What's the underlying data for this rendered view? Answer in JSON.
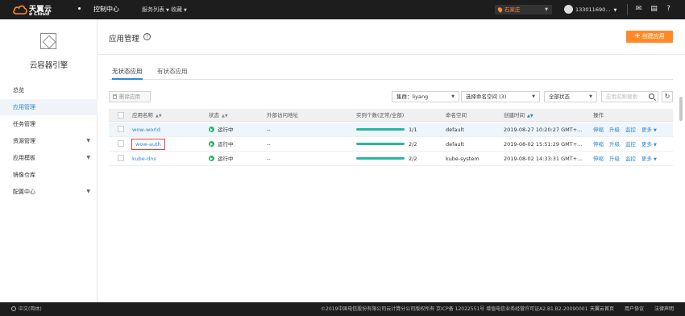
{
  "topbar": {
    "logo_cn": "天翼云",
    "logo_en": "e Cloud",
    "nav": [
      {
        "label": "控制中心"
      },
      {
        "label": "服务列表"
      },
      {
        "label": "收藏"
      }
    ],
    "region": "石家庄",
    "user": "133011690...",
    "icons": [
      "mail-icon",
      "file-icon",
      "help-icon"
    ]
  },
  "sidebar": {
    "title": "云容器引擎",
    "items": [
      {
        "label": "总览"
      },
      {
        "label": "应用管理"
      },
      {
        "label": "任务管理"
      },
      {
        "label": "资源管理"
      },
      {
        "label": "应用模板"
      },
      {
        "label": "镜像仓库"
      },
      {
        "label": "配置中心"
      }
    ]
  },
  "page": {
    "title": "应用管理",
    "create_label": "创建应用",
    "tabs": [
      {
        "label": "无状态应用"
      },
      {
        "label": "有状态应用"
      }
    ]
  },
  "toolbar": {
    "delete_label": "删除应用",
    "cluster_label": "集群：liyang",
    "namespace_label": "选择命名空间 (3)",
    "status_label": "全部状态",
    "search_placeholder": "应用名称搜索"
  },
  "table": {
    "headers": [
      "应用名称",
      "状态",
      "外部访问地址",
      "实例个数(正常/全部)",
      "命名空间",
      "创建时间",
      "操作"
    ],
    "rows": [
      {
        "name": "wow-world",
        "status": "运行中",
        "address": "--",
        "instances": "1/1",
        "ratio": 1,
        "namespace": "default",
        "created": "2019-08-27 10:20:27 GMT+..."
      },
      {
        "name": "wow-auth",
        "status": "运行中",
        "address": "--",
        "instances": "2/2",
        "ratio": 1,
        "namespace": "default",
        "created": "2019-08-02 15:51:29 GMT+..."
      },
      {
        "name": "kube-dns",
        "status": "运行中",
        "address": "--",
        "instances": "2/2",
        "ratio": 1,
        "namespace": "kube-system",
        "created": "2019-08-02 14:33:31 GMT+..."
      }
    ],
    "actions": [
      "伸缩",
      "升级",
      "监控",
      "更多"
    ]
  },
  "footer": {
    "lang": "中文(简体)",
    "copyright": "©2019中国电信股份有限公司云计算分公司版权所有 京ICP备 12022551号 增值电信业务经营许可证A2.B1.B2-20090001",
    "links": [
      "天翼云首页",
      "用户协议",
      "法律声明"
    ]
  },
  "colors": {
    "accent": "#2e87d1",
    "brand": "#ff8a2a",
    "running": "#29b36b",
    "progress": "#29b6a0"
  }
}
